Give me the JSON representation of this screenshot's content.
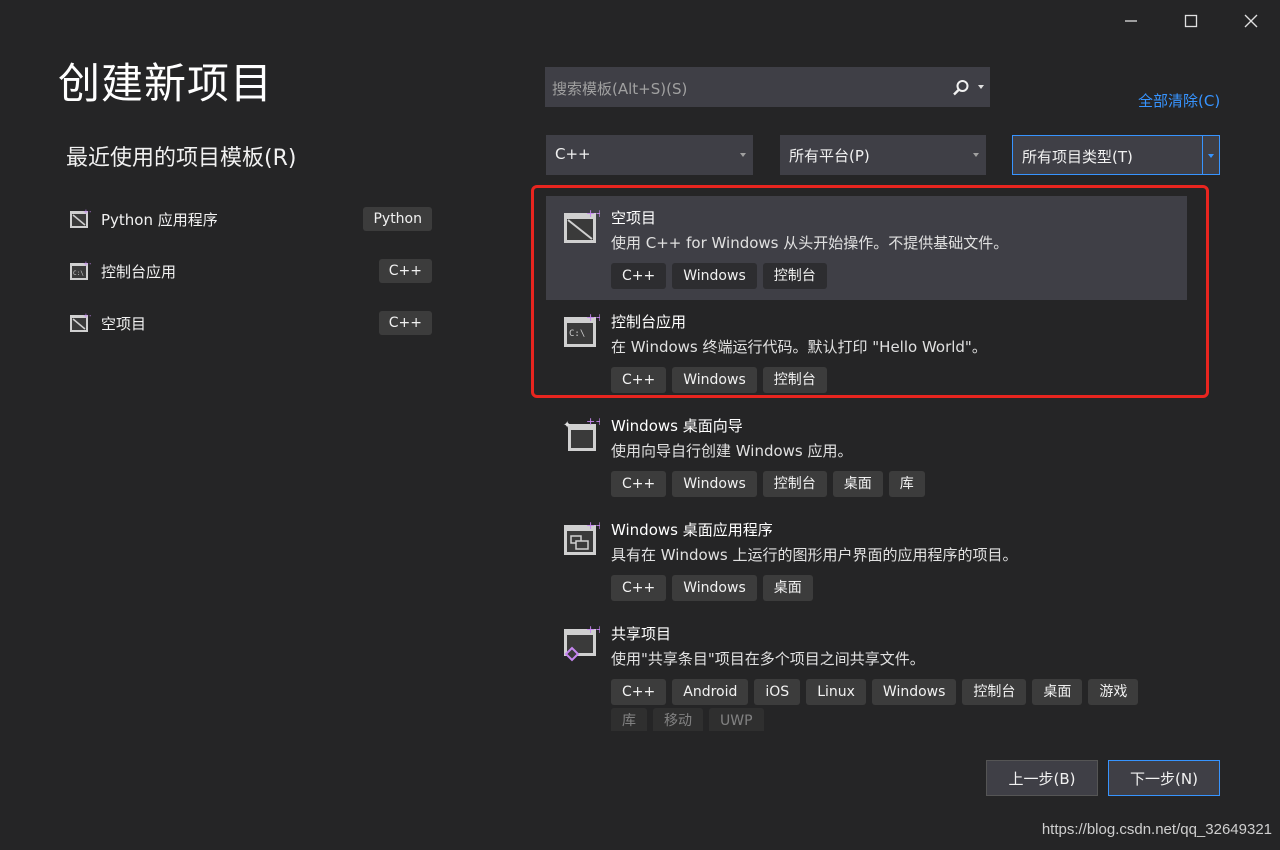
{
  "window": {
    "controls": [
      "minimize-icon",
      "maximize-icon",
      "close-icon"
    ]
  },
  "page": {
    "title": "创建新项目"
  },
  "recent": {
    "title": "最近使用的项目模板(R)",
    "items": [
      {
        "label": "Python 应用程序",
        "tag": "Python",
        "icon": "python-app-icon"
      },
      {
        "label": "控制台应用",
        "tag": "C++",
        "icon": "console-app-icon"
      },
      {
        "label": "空项目",
        "tag": "C++",
        "icon": "empty-project-icon"
      }
    ]
  },
  "search": {
    "placeholder": "搜索模板(Alt+S)(S)",
    "icon": "search-icon"
  },
  "clear_all": "全部清除(C)",
  "filters": {
    "language": "C++",
    "platform": "所有平台(P)",
    "project_type": "所有项目类型(T)"
  },
  "templates": [
    {
      "name": "空项目",
      "description": "使用 C++ for Windows 从头开始操作。不提供基础文件。",
      "tags": [
        "C++",
        "Windows",
        "控制台"
      ],
      "icon": "empty-project-icon",
      "selected": true
    },
    {
      "name": "控制台应用",
      "description": "在 Windows 终端运行代码。默认打印 \"Hello World\"。",
      "tags": [
        "C++",
        "Windows",
        "控制台"
      ],
      "icon": "console-app-icon"
    },
    {
      "name": "Windows 桌面向导",
      "description": "使用向导自行创建 Windows 应用。",
      "tags": [
        "C++",
        "Windows",
        "控制台",
        "桌面",
        "库"
      ],
      "icon": "wizard-icon"
    },
    {
      "name": "Windows 桌面应用程序",
      "description": "具有在 Windows 上运行的图形用户界面的应用程序的项目。",
      "tags": [
        "C++",
        "Windows",
        "桌面"
      ],
      "icon": "desktop-app-icon"
    },
    {
      "name": "共享项目",
      "description": "使用\"共享条目\"项目在多个项目之间共享文件。",
      "tags": [
        "C++",
        "Android",
        "iOS",
        "Linux",
        "Windows",
        "控制台",
        "桌面",
        "游戏",
        "库",
        "移动",
        "UWP"
      ],
      "icon": "shared-project-icon"
    }
  ],
  "buttons": {
    "prev": "上一步(B)",
    "next": "下一步(N)"
  },
  "watermark": "https://blog.csdn.net/qq_32649321",
  "colors": {
    "background": "#252526",
    "accent": "#3794ff",
    "highlight": "#e8251f"
  }
}
